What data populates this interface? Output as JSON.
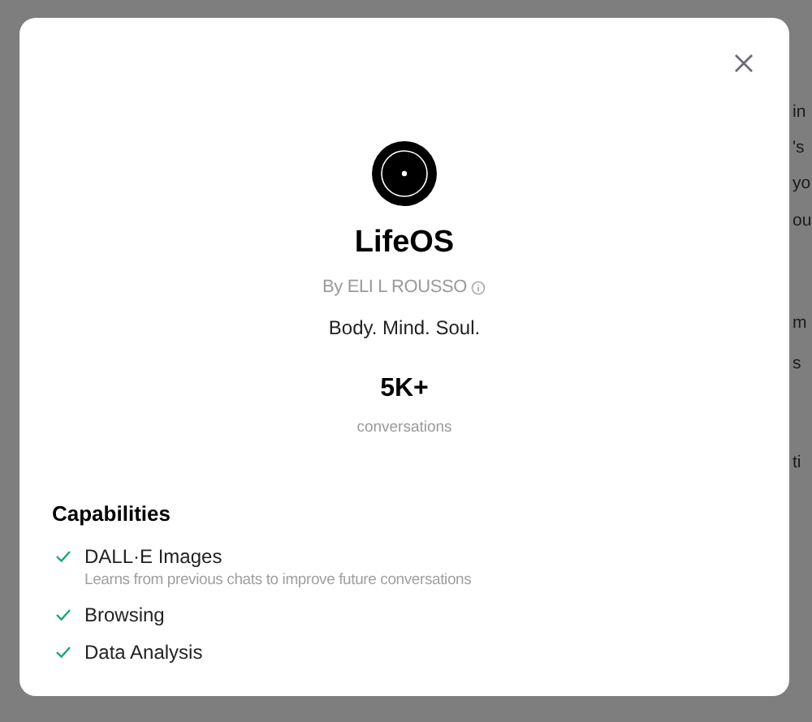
{
  "background_text": [
    "in",
    "'s",
    "yo",
    "ou",
    "m",
    "s",
    "ti"
  ],
  "dialog": {
    "name": "LifeOS",
    "author": "By ELI L ROUSSO",
    "tagline": "Body. Mind. Soul.",
    "stat": {
      "value": "5K+",
      "label": "conversations"
    },
    "capabilities_heading": "Capabilities",
    "capabilities": [
      {
        "label": "DALL·E Images",
        "description": "Learns from previous chats to improve future conversations"
      },
      {
        "label": "Browsing"
      },
      {
        "label": "Data Analysis"
      }
    ]
  }
}
